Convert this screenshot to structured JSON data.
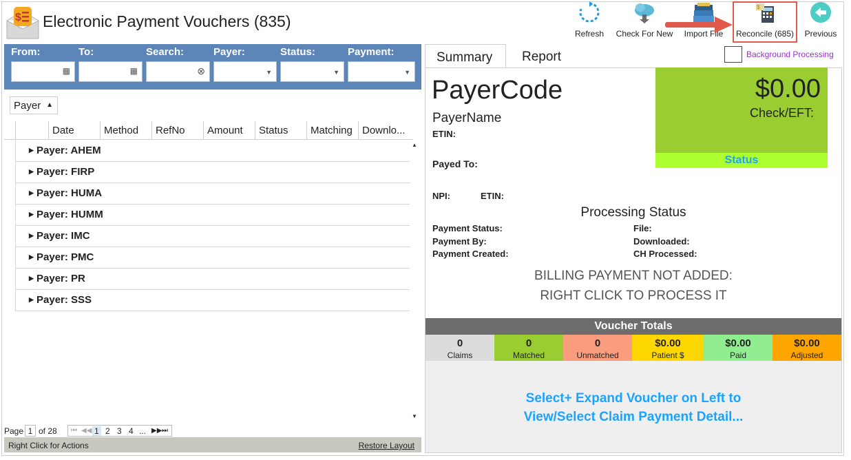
{
  "app": {
    "title": "Electronic Payment Vouchers (835)",
    "icon": "dollar-envelope-icon"
  },
  "toolbar": {
    "refresh": "Refresh",
    "check_for_new": "Check For New",
    "import_file": "Import File",
    "reconcile": "Reconcile (685)",
    "previous": "Previous"
  },
  "filters": {
    "from": "From:",
    "to": "To:",
    "search": "Search:",
    "payer": "Payer:",
    "status": "Status:",
    "payment": "Payment:"
  },
  "group_chip": "Payer",
  "grid": {
    "columns": [
      "Date",
      "Method",
      "RefNo",
      "Amount",
      "Status",
      "Matching",
      "Downlo..."
    ],
    "rows": [
      "Payer: AHEM",
      "Payer: FIRP",
      "Payer: HUMA",
      "Payer: HUMM",
      "Payer: IMC",
      "Payer: PMC",
      "Payer: PR",
      "Payer: SSS"
    ]
  },
  "pager": {
    "page_label": "Page",
    "current": "1",
    "of_label": "of 28",
    "pages": [
      "1",
      "2",
      "3",
      "4",
      "..."
    ]
  },
  "status_bar": {
    "left": "Right Click for Actions",
    "right": "Restore Layout"
  },
  "tabs": [
    "Summary",
    "Report"
  ],
  "background_processing": "Background Processing",
  "summary": {
    "payer_code": "PayerCode",
    "payer_name": "PayerName",
    "etin": "ETIN:",
    "payed_to": "Payed To:",
    "npi": "NPI:",
    "etin2": "ETIN:",
    "amount": "$0.00",
    "check_eft": "Check/EFT:",
    "status_label": "Status",
    "processing_status": "Processing Status",
    "payment_status": "Payment Status:",
    "payment_by": "Payment By:",
    "payment_created": "Payment Created:",
    "file": "File:",
    "downloaded": "Downloaded:",
    "ch_processed": "CH Processed:",
    "billing_line1": "BILLING PAYMENT NOT ADDED:",
    "billing_line2": "RIGHT CLICK TO PROCESS IT"
  },
  "voucher_totals": {
    "title": "Voucher Totals",
    "cells": [
      {
        "value": "0",
        "label": "Claims",
        "color": "#dcdcdc"
      },
      {
        "value": "0",
        "label": "Matched",
        "color": "#9acd32"
      },
      {
        "value": "0",
        "label": "Unmatched",
        "color": "#fa9d7e"
      },
      {
        "value": "$0.00",
        "label": "Patient $",
        "color": "#ffd700"
      },
      {
        "value": "$0.00",
        "label": "Paid",
        "color": "#90ee90"
      },
      {
        "value": "$0.00",
        "label": "Adjusted",
        "color": "#ffa500"
      }
    ]
  },
  "hint": {
    "line1": "Select+ Expand Voucher on Left to",
    "line2": "View/Select Claim Payment Detail..."
  },
  "colors": {
    "filter_bar": "#5c86b8",
    "amount_box": "#9acd32",
    "status_strip": "#adff2f",
    "accent_blue": "#1aa3ff",
    "highlight_red": "#e05a4b"
  }
}
